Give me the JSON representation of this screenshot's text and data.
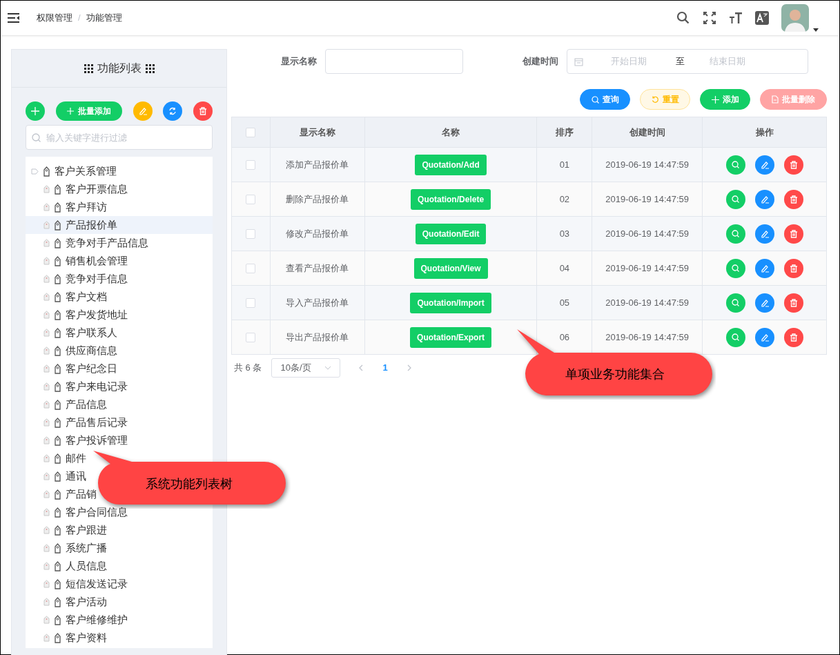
{
  "breadcrumb": [
    "权限管理",
    "功能管理"
  ],
  "breadcrumb_separator": "/",
  "panel": {
    "title": "功能列表",
    "batch_add": "批量添加",
    "filter_placeholder": "输入关键字进行过滤"
  },
  "tree": [
    {
      "label": "客户关系管理",
      "expanded": true,
      "selected": false,
      "children": [
        {
          "label": "客户开票信息",
          "selected": false
        },
        {
          "label": "客户拜访",
          "selected": false
        },
        {
          "label": "产品报价单",
          "selected": true
        },
        {
          "label": "竞争对手产品信息",
          "selected": false
        },
        {
          "label": "销售机会管理",
          "selected": false
        },
        {
          "label": "竞争对手信息",
          "selected": false
        },
        {
          "label": "客户文档",
          "selected": false
        },
        {
          "label": "客户发货地址",
          "selected": false
        },
        {
          "label": "客户联系人",
          "selected": false
        },
        {
          "label": "供应商信息",
          "selected": false
        },
        {
          "label": "客户纪念日",
          "selected": false
        },
        {
          "label": "客户来电记录",
          "selected": false
        },
        {
          "label": "产品信息",
          "selected": false
        },
        {
          "label": "产品售后记录",
          "selected": false
        },
        {
          "label": "客户投诉管理",
          "selected": false
        },
        {
          "label": "邮件",
          "selected": false
        },
        {
          "label": "通讯",
          "selected": false
        },
        {
          "label": "产品销",
          "selected": false
        },
        {
          "label": "客户合同信息",
          "selected": false
        },
        {
          "label": "客户跟进",
          "selected": false
        },
        {
          "label": "系统广播",
          "selected": false
        },
        {
          "label": "人员信息",
          "selected": false
        },
        {
          "label": "短信发送记录",
          "selected": false
        },
        {
          "label": "客户活动",
          "selected": false
        },
        {
          "label": "客户维修维护",
          "selected": false
        },
        {
          "label": "客户资料",
          "selected": false
        }
      ]
    }
  ],
  "search": {
    "name_label": "显示名称",
    "time_label": "创建时间",
    "start_placeholder": "开始日期",
    "separator": "至",
    "end_placeholder": "结束日期"
  },
  "actions": [
    {
      "kind": "query",
      "label": "查询"
    },
    {
      "kind": "reset",
      "label": "重置"
    },
    {
      "kind": "add",
      "label": "添加"
    },
    {
      "kind": "batch_delete",
      "label": "批量删除"
    }
  ],
  "table": {
    "select_all": {
      "checked": false
    },
    "columns": [
      "显示名称",
      "名称",
      "排序",
      "创建时间",
      "操作"
    ],
    "rows": [
      {
        "display_name": "添加产品报价单",
        "name": "Quotation/Add",
        "order": "01",
        "created": "2019-06-19 14:47:59",
        "checked": false
      },
      {
        "display_name": "删除产品报价单",
        "name": "Quotation/Delete",
        "order": "02",
        "created": "2019-06-19 14:47:59",
        "checked": false
      },
      {
        "display_name": "修改产品报价单",
        "name": "Quotation/Edit",
        "order": "03",
        "created": "2019-06-19 14:47:59",
        "checked": false
      },
      {
        "display_name": "查看产品报价单",
        "name": "Quotation/View",
        "order": "04",
        "created": "2019-06-19 14:47:59",
        "checked": false
      },
      {
        "display_name": "导入产品报价单",
        "name": "Quotation/Import",
        "order": "05",
        "created": "2019-06-19 14:47:59",
        "checked": false
      },
      {
        "display_name": "导出产品报价单",
        "name": "Quotation/Export",
        "order": "06",
        "created": "2019-06-19 14:47:59",
        "checked": false
      }
    ]
  },
  "pagination": {
    "total": "共 6 条",
    "page_size": "10条/页",
    "pages": [
      {
        "label": "1",
        "selected": true
      }
    ]
  },
  "callouts": [
    {
      "text": "系统功能列表树"
    },
    {
      "text": "单项业务功能集合"
    }
  ]
}
